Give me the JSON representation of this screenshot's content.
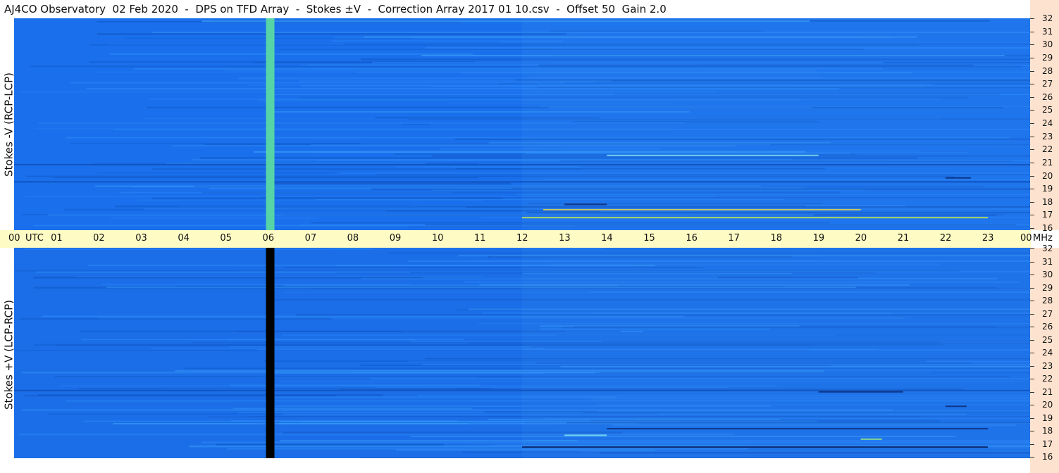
{
  "title": "AJ4CO Observatory  02 Feb 2020  -  DPS on TFD Array  -  Stokes ±V  -  Correction Array 2017 01 10.csv  -  Offset 50  Gain 2.0",
  "chart_data": {
    "type": "heatmap",
    "title": "AJ4CO Observatory  02 Feb 2020  -  DPS on TFD Array  -  Stokes ±V  -  Correction Array 2017 01 10.csv  -  Offset 50  Gain 2.0",
    "x_axis": {
      "unit_label": "UTC",
      "ticks": [
        "00",
        "01",
        "02",
        "03",
        "04",
        "05",
        "06",
        "07",
        "08",
        "09",
        "10",
        "11",
        "12",
        "13",
        "14",
        "15",
        "16",
        "17",
        "18",
        "19",
        "20",
        "21",
        "22",
        "23",
        "00"
      ],
      "range_hours": [
        0,
        24
      ]
    },
    "y_axis": {
      "unit_label": "MHz",
      "ticks": [
        16,
        17,
        18,
        19,
        20,
        21,
        22,
        23,
        24,
        25,
        26,
        27,
        28,
        29,
        30,
        31,
        32
      ],
      "range_mhz": [
        16,
        32
      ]
    },
    "panels": [
      {
        "name": "top",
        "ylabel": "Stokes -V (RCP-LCP)",
        "base_color": "#1a70ec",
        "gap_hour": 6.05,
        "gap_color": "#56d4a8",
        "features": [
          {
            "hour_start": 12.0,
            "hour_end": 23.0,
            "mhz": 17.0,
            "color": "#c8e64a"
          },
          {
            "hour_start": 12.5,
            "hour_end": 20.0,
            "mhz": 17.6,
            "color": "#e6d24a"
          },
          {
            "hour_start": 13.0,
            "hour_end": 14.0,
            "mhz": 18.0,
            "color": "#0b2c78"
          },
          {
            "hour_start": 14.0,
            "hour_end": 19.0,
            "mhz": 21.7,
            "color": "#7fe0f0"
          },
          {
            "hour_start": 22.0,
            "hour_end": 22.6,
            "mhz": 20.0,
            "color": "#0b2c78"
          },
          {
            "hour_start": 0.0,
            "hour_end": 24.0,
            "mhz": 21.0,
            "color": "#0f4fb8"
          },
          {
            "hour_start": 0.0,
            "hour_end": 24.0,
            "mhz": 19.7,
            "color": "#0f4fb8"
          }
        ]
      },
      {
        "name": "bottom",
        "ylabel": "Stokes +V (LCP-RCP)",
        "base_color": "#1b6ee8",
        "gap_hour": 6.05,
        "gap_color": "#000000",
        "features": [
          {
            "hour_start": 12.0,
            "hour_end": 23.0,
            "mhz": 16.9,
            "color": "#061a55"
          },
          {
            "hour_start": 13.0,
            "hour_end": 14.0,
            "mhz": 17.8,
            "color": "#7fe0f0"
          },
          {
            "hour_start": 20.0,
            "hour_end": 20.5,
            "mhz": 17.5,
            "color": "#8ee08a"
          },
          {
            "hour_start": 14.0,
            "hour_end": 23.0,
            "mhz": 18.3,
            "color": "#0b2c78"
          },
          {
            "hour_start": 19.0,
            "hour_end": 21.0,
            "mhz": 21.1,
            "color": "#0b2c78"
          },
          {
            "hour_start": 0.0,
            "hour_end": 24.0,
            "mhz": 21.2,
            "color": "#0f4fb8"
          },
          {
            "hour_start": 22.0,
            "hour_end": 22.5,
            "mhz": 20.0,
            "color": "#0b2c78"
          }
        ]
      }
    ]
  }
}
